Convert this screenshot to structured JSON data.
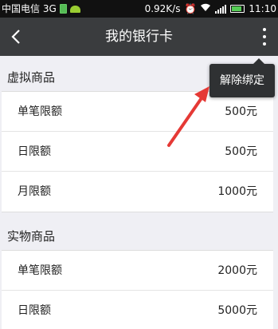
{
  "status_bar": {
    "carrier": "中国电信 3G",
    "net_speed": "0.92K/s",
    "time": "11:10",
    "icons": [
      "sim-icon",
      "android-icon",
      "alarm-icon",
      "wifi-icon",
      "signal-icon",
      "battery-icon"
    ]
  },
  "navbar": {
    "title": "我的银行卡",
    "back_icon": "chevron-left-icon",
    "more_icon": "more-vertical-icon"
  },
  "popup_menu": {
    "items": [
      {
        "label": "解除绑定"
      }
    ]
  },
  "sections": [
    {
      "title": "虚拟商品",
      "rows": [
        {
          "label": "单笔限额",
          "value": "500元"
        },
        {
          "label": "日限额",
          "value": "500元"
        },
        {
          "label": "月限额",
          "value": "1000元"
        }
      ]
    },
    {
      "title": "实物商品",
      "rows": [
        {
          "label": "单笔限额",
          "value": "2000元"
        },
        {
          "label": "日限额",
          "value": "5000元"
        }
      ]
    }
  ],
  "colors": {
    "navbar_bg": "#3a3c3e",
    "page_bg": "#efeff4",
    "popup_bg": "#2f3133",
    "annotation_arrow": "#e53935"
  }
}
